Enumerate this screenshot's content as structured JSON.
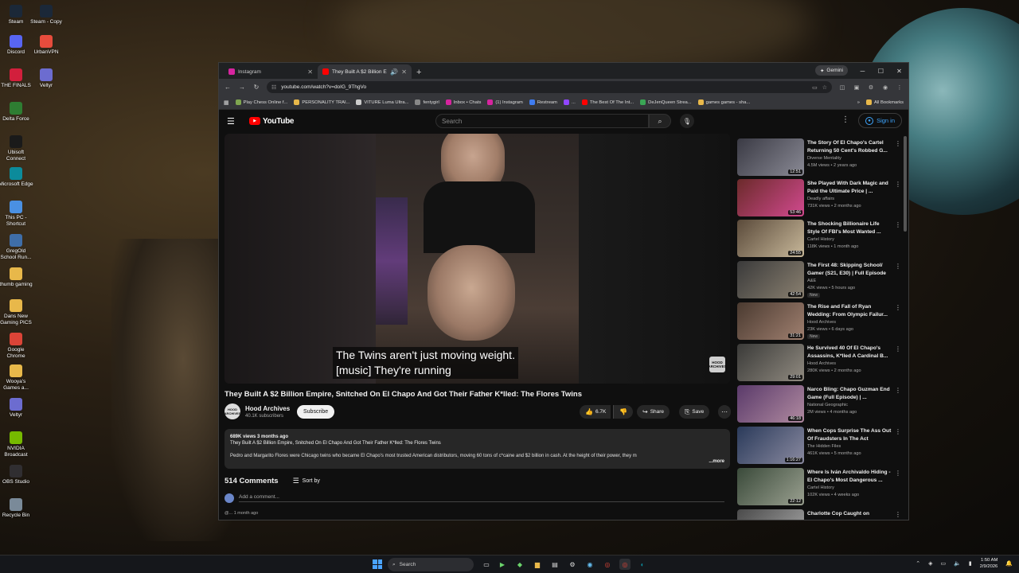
{
  "desktop": {
    "icons": [
      {
        "label": "Steam",
        "icon": "steam-icon",
        "color": "#1b2838"
      },
      {
        "label": "Steam - Copy",
        "icon": "steam-icon",
        "color": "#1b2838"
      },
      {
        "label": "Discord",
        "icon": "discord-icon",
        "color": "#5865f2"
      },
      {
        "label": "UrbanVPN",
        "icon": "vpn-icon",
        "color": "#e74c3c"
      },
      {
        "label": "THE FINALS",
        "icon": "game-icon",
        "color": "#d21f3c"
      },
      {
        "label": "Veltyr",
        "icon": "app-icon",
        "color": "#6c6cd0"
      },
      {
        "label": "Delta Force",
        "icon": "game-icon",
        "color": "#2e7d32"
      },
      {
        "label": "Ubisoft Connect",
        "icon": "ubisoft-icon",
        "color": "#1a1a1a"
      },
      {
        "label": "Microsoft Edge",
        "icon": "edge-icon",
        "color": "#0c8b9b"
      },
      {
        "label": "This PC - Shortcut",
        "icon": "computer-icon",
        "color": "#4a90e2"
      },
      {
        "label": "GregOld School Run...",
        "icon": "game-icon",
        "color": "#3f6ea8"
      },
      {
        "label": "thumb gaming",
        "icon": "folder-icon",
        "color": "#e8b84a"
      },
      {
        "label": "Dans New Gaming PICS",
        "icon": "folder-icon",
        "color": "#e8b84a"
      },
      {
        "label": "Google Chrome",
        "icon": "chrome-icon",
        "color": "#db4437"
      },
      {
        "label": "Wooya's Games a...",
        "icon": "folder-icon",
        "color": "#e8b84a"
      },
      {
        "label": "Veltyr",
        "icon": "app-icon",
        "color": "#6c6cd0"
      },
      {
        "label": "NVIDIA Broadcast",
        "icon": "nvidia-icon",
        "color": "#76b900"
      },
      {
        "label": "OBS Studio",
        "icon": "obs-icon",
        "color": "#302e31"
      },
      {
        "label": "Recycle Bin",
        "icon": "recycle-bin-icon",
        "color": "#7a8a99"
      }
    ]
  },
  "browser": {
    "tabs": [
      {
        "title": "Instagram",
        "favicon_color": "#d6249f",
        "active": false
      },
      {
        "title": "They Built A $2 Billion Emp",
        "favicon_color": "#ff0000",
        "active": true
      }
    ],
    "new_tab_symbol": "+",
    "gemini_label": "Gemini",
    "url": "youtube.com/watch?v=doIG_9ThgVo",
    "bookmarks": [
      {
        "label": "Play Chess Online f...",
        "color": "#7fa650"
      },
      {
        "label": "PERSONALITY TRAI...",
        "color": "#e8b84a"
      },
      {
        "label": "VITURE Luma Ultra...",
        "color": "#cccccc"
      },
      {
        "label": "fentygirl",
        "color": "#888888"
      },
      {
        "label": "Inbox • Chats",
        "color": "#d6249f"
      },
      {
        "label": "(1) Instagram",
        "color": "#d6249f"
      },
      {
        "label": "Restream",
        "color": "#3f7cf0"
      },
      {
        "label": "...",
        "color": "#9146ff"
      },
      {
        "label": "The Best Of The Int...",
        "color": "#ff0000"
      },
      {
        "label": "DeJenQueen Strea...",
        "color": "#3aa655"
      },
      {
        "label": "games games - sha...",
        "color": "#e8b84a"
      }
    ],
    "all_bookmarks": "All Bookmarks"
  },
  "youtube": {
    "logo_text": "YouTube",
    "search_placeholder": "Search",
    "sign_in": "Sign in",
    "caption_line1": "The Twins aren't just moving weight.",
    "caption_line2": "[music] They're running",
    "watermark": "HOOD ARCHIVES",
    "video_title": "They Built A $2 Billion Empire, Snitched On El Chapo And Got Their Father K*lled: The Flores Twins",
    "channel_name": "Hood Archives",
    "subscribers": "40.1K subscribers",
    "subscribe_label": "Subscribe",
    "likes": "6.7K",
    "share_label": "Share",
    "save_label": "Save",
    "description_meta": "689K views  3 months ago",
    "description_title": "They Built A $2 Billion Empire, Snitched On El Chapo And Got Their Father K*lled: The Flores Twins",
    "description_body": "Pedro and Margarito Flores were Chicago twins who became El Chapo's most trusted American distributors, moving 60 tons of c*caine and $2 billion in cash. At the height of their power, they m",
    "more_label": "...more",
    "comments_count": "514 Comments",
    "sort_by": "Sort by",
    "add_comment": "Add a comment...",
    "next_comment": "@... 1 month ago",
    "recommendations": [
      {
        "title": "The Story Of El Chapo's Cartel Returning 50 Cent's Robbed G...",
        "channel": "Diverse Mentality",
        "stats": "4.5M views • 2 years ago",
        "duration": "12:51",
        "thumb_a": "#3a3a44",
        "thumb_b": "#8a8a95",
        "new": ""
      },
      {
        "title": "She Played With Dark Magic and Paid the Ultimate Price | ...",
        "channel": "Deadly affairs",
        "stats": "731K views • 2 months ago",
        "duration": "53:46",
        "thumb_a": "#6b2a2a",
        "thumb_b": "#d24a8f",
        "new": ""
      },
      {
        "title": "The Shocking Billionaire Life Style Of FBI's Most Wanted ...",
        "channel": "Cartel History",
        "stats": "118K views • 1 month ago",
        "duration": "24:55",
        "thumb_a": "#5a4a3a",
        "thumb_b": "#c8b89a",
        "new": ""
      },
      {
        "title": "The First 48: Skipping School/ Gamer (S21, E30) | Full Episode",
        "channel": "A&E",
        "stats": "42K views • 5 hours ago",
        "duration": "42:54",
        "thumb_a": "#3a3a3a",
        "thumb_b": "#8a8070",
        "new": "New"
      },
      {
        "title": "The Rise and Fall of Ryan Wedding: From Olympic Failur...",
        "channel": "Hood Archives",
        "stats": "23K views • 6 days ago",
        "duration": "31:21",
        "thumb_a": "#4a3a30",
        "thumb_b": "#a08070",
        "new": "New"
      },
      {
        "title": "He Survived 40 Of El Chapo's Assassins, K*lled A Cardinal B...",
        "channel": "Hood Archives",
        "stats": "280K views • 2 months ago",
        "duration": "29:01",
        "thumb_a": "#3a3a38",
        "thumb_b": "#908a80",
        "new": ""
      },
      {
        "title": "Narco Bling: Chapo Guzman End Game (Full Episode) | ...",
        "channel": "National Geographic",
        "stats": "2M views • 4 months ago",
        "duration": "46:18",
        "thumb_a": "#5a3a6a",
        "thumb_b": "#b08aa0",
        "new": ""
      },
      {
        "title": "When Cops Surprise The Ass Out Of Fraudsters In The Act",
        "channel": "The Hidden Files",
        "stats": "461K views • 5 months ago",
        "duration": "1:16:27",
        "thumb_a": "#2a3a5a",
        "thumb_b": "#8a8aa0",
        "new": ""
      },
      {
        "title": "Where Is Iván Archivaldo Hiding - El Chapo's Most Dangerous ...",
        "channel": "Cartel History",
        "stats": "102K views • 4 weeks ago",
        "duration": "22:12",
        "thumb_a": "#3a4a3a",
        "thumb_b": "#9aa090",
        "new": ""
      },
      {
        "title": "Charlotte Cop Caught on",
        "channel": "",
        "stats": "",
        "duration": "",
        "thumb_a": "#4a4a4a",
        "thumb_b": "#aaaaaa",
        "new": ""
      }
    ]
  },
  "taskbar": {
    "search_label": "Search",
    "time": "1:50 AM",
    "date": "2/9/2026"
  }
}
